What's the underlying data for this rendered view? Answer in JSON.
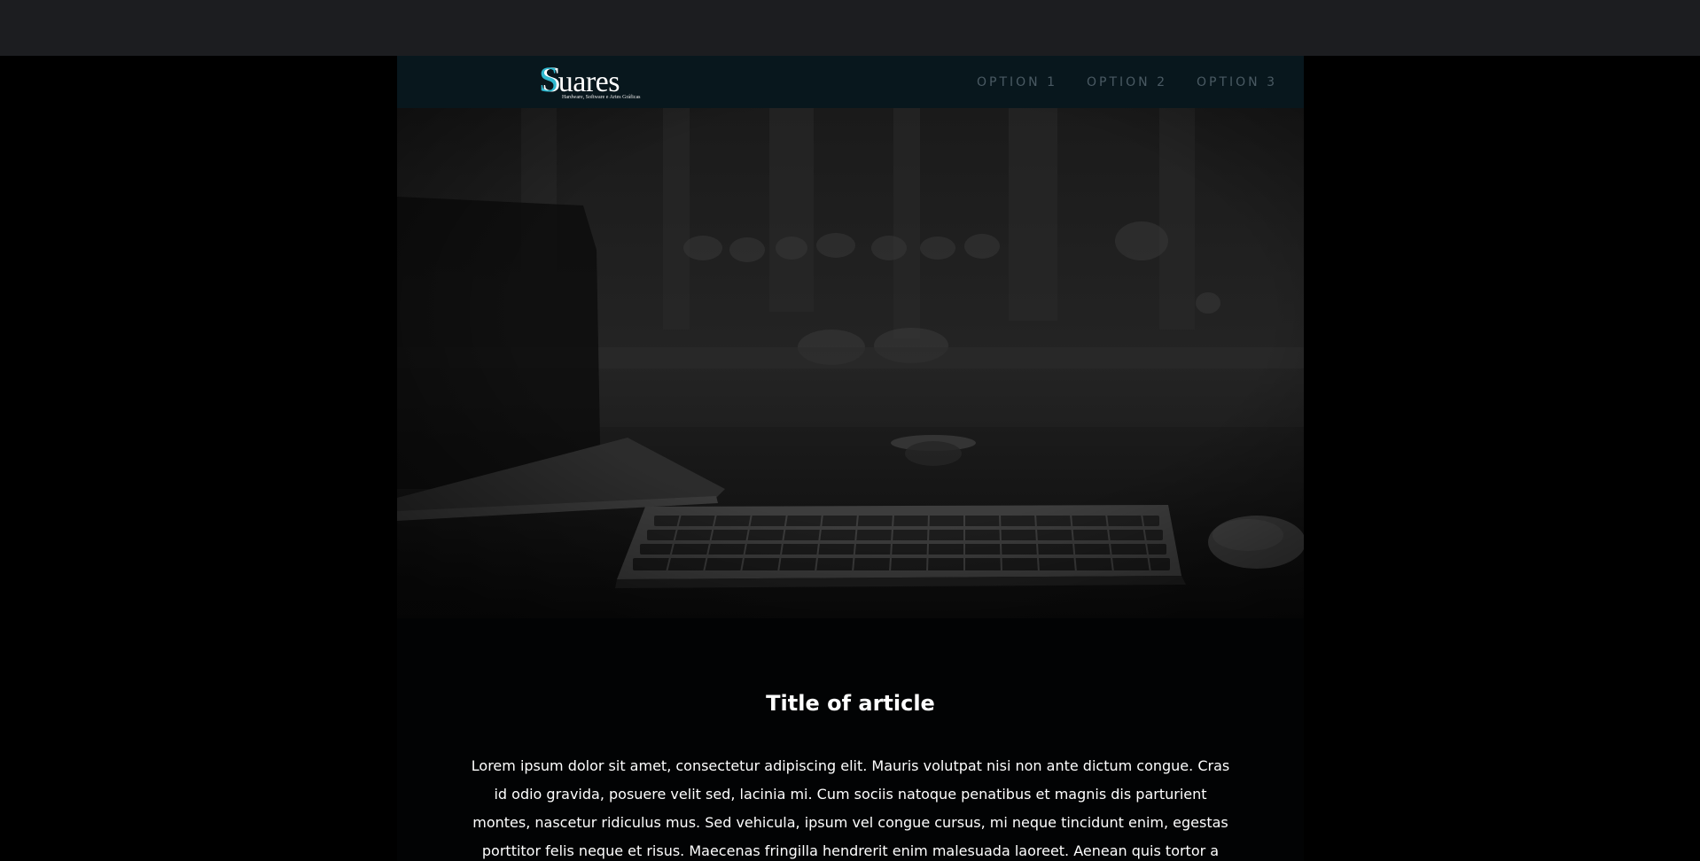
{
  "brand": {
    "logo_text": "Suares",
    "logo_initial": "S",
    "logo_rest": "uares",
    "tagline": "Hardware, Software e Artes Gráficas",
    "accent_color": "#2fb8cf"
  },
  "nav": {
    "items": [
      {
        "label": "OPTION 1"
      },
      {
        "label": "OPTION 2"
      },
      {
        "label": "OPTION 3"
      }
    ]
  },
  "hero": {
    "image_icon": "desk-keyboard-photo"
  },
  "article": {
    "title": "Title of article",
    "body": "Lorem ipsum dolor sit amet, consectetur adipiscing elit. Mauris volutpat nisi non ante dictum congue. Cras id odio gravida, posuere velit sed, lacinia mi. Cum sociis natoque penatibus et magnis dis parturient montes, nascetur ridiculus mus. Sed vehicula, ipsum vel congue cursus, mi neque tincidunt enim, egestas porttitor felis neque et risus. Maecenas fringilla hendrerit enim malesuada laoreet. Aenean quis tortor a"
  }
}
